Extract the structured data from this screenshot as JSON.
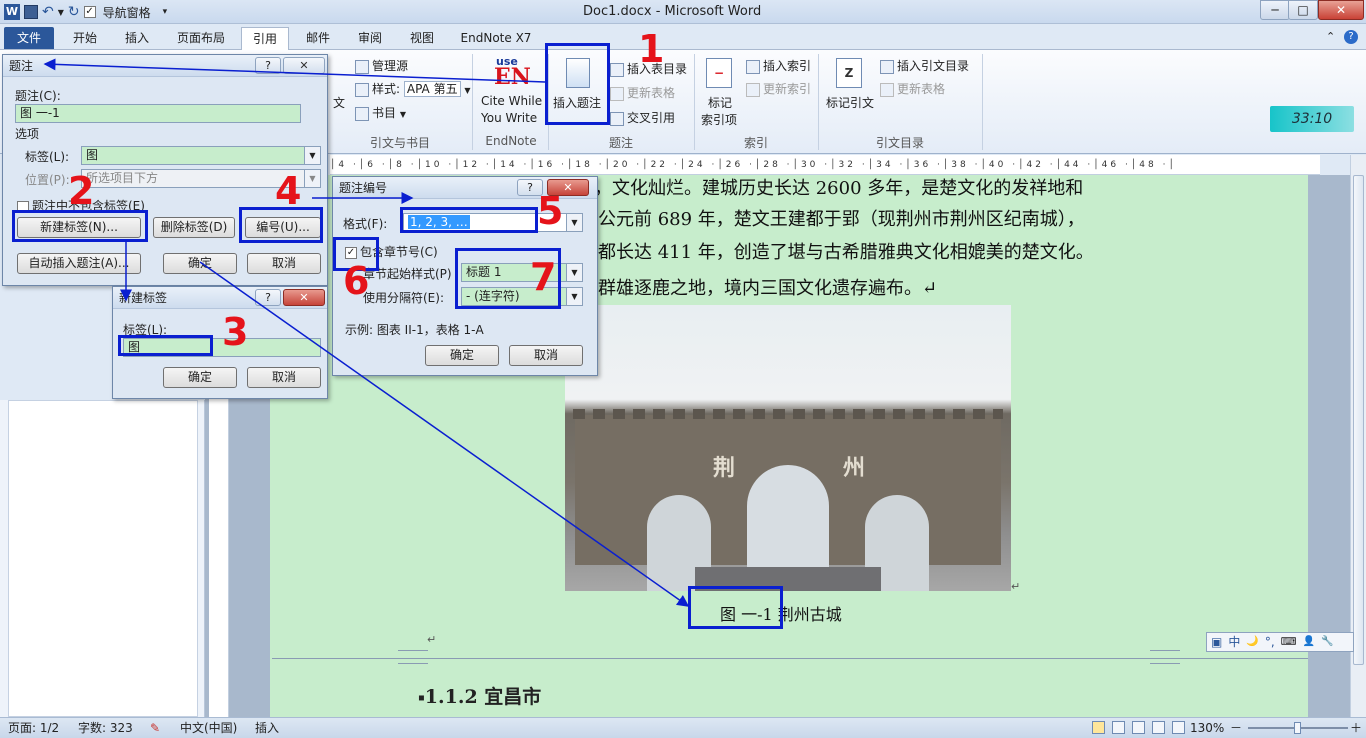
{
  "window": {
    "title": "Doc1.docx - Microsoft Word",
    "quick_access_label": "导航窗格",
    "word_icon": "W",
    "min": "─",
    "max": "□",
    "close": "✕"
  },
  "tabs": [
    "文件",
    "开始",
    "插入",
    "页面布局",
    "引用",
    "邮件",
    "审阅",
    "视图",
    "EndNote X7"
  ],
  "ribbon": {
    "citations": {
      "manage": "管理源",
      "style_label": "样式:",
      "style_value": "APA 第五",
      "bib": "书目",
      "group": "引文与书目",
      "partial": "文"
    },
    "endnote": {
      "logo_top": "use",
      "logo": "EN",
      "line1": "Cite While",
      "line2": "You Write",
      "group": "EndNote"
    },
    "captions": {
      "insert_caption": "插入题注",
      "insert_table_figures": "插入表目录",
      "update_table": "更新表格",
      "cross_ref": "交叉引用",
      "group": "题注"
    },
    "index": {
      "insert_index": "插入索引",
      "update_index": "更新索引",
      "mark_entry_1": "标记",
      "mark_entry_2": "索引项",
      "group": "索引"
    },
    "toa": {
      "insert_toa": "插入引文目录",
      "update_table": "更新表格",
      "mark_citation": "标记引文",
      "group": "引文目录"
    }
  },
  "timer": "33:10",
  "ruler_text": "│4 ·│6 ·│8 ·│10 ·│12 ·│14 ·│16 ·│18 ·│20 ·│22 ·│24 ·│26 ·│28 ·│30 ·│32 ·│34 ·│36 ·│38 ·│40 ·│42 ·│44 ·│46 ·│48 ·│",
  "document": {
    "line1": "，文化灿烂。建城历史长达 2600 多年，是楚文化的发祥地和",
    "line2": "公元前 689 年，楚文王建都于郢（现荆州市荆州区纪南城），",
    "line3": "都长达 411 年，创造了堪与古希腊雅典文化相媲美的楚文化。",
    "line4": "群雄逐鹿之地，境内三国文化遗存遍布。↵",
    "photo_sign_left": "荆",
    "photo_sign_right": "州",
    "caption": "图  一-1 荆州古城",
    "heading": "1.1.2 宜昌市",
    "para_mark": "↵"
  },
  "ime": [
    "中",
    "🌙",
    "°,",
    "⌨",
    "👤",
    "🔧"
  ],
  "caption_dialog": {
    "title": "题注",
    "q": "?",
    "x": "✕",
    "caption_label": "题注(C):",
    "caption_value": "图  一-1",
    "options": "选项",
    "label_label": "标签(L):",
    "label_value": "图",
    "position_label": "位置(P):",
    "position_value": "所选项目下方",
    "exclude_label": "题注中不包含标签(E)",
    "new_label": "新建标签(N)...",
    "delete_label": "删除标签(D)",
    "numbering": "编号(U)...",
    "autocaption": "自动插入题注(A)...",
    "ok": "确定",
    "cancel": "取消"
  },
  "new_label_dialog": {
    "title": "新建标签",
    "q": "?",
    "x": "✕",
    "label": "标签(L):",
    "value": "图",
    "ok": "确定",
    "cancel": "取消"
  },
  "numbering_dialog": {
    "title": "题注编号",
    "q": "?",
    "x": "✕",
    "format_label": "格式(F):",
    "format_value": "1, 2, 3, …",
    "include_chapter": "包含章节号(C)",
    "chapter_style_label": "章节起始样式(P)",
    "chapter_style_value": "标题 1",
    "separator_label": "使用分隔符(E):",
    "separator_value": "-   (连字符)",
    "example": "示例:  图表 II-1，表格 1-A",
    "ok": "确定",
    "cancel": "取消"
  },
  "annotations": [
    "1",
    "2",
    "3",
    "4",
    "5",
    "6",
    "7"
  ],
  "status": {
    "page": "页面: 1/2",
    "words": "字数: 323",
    "lang": "中文(中国)",
    "mode": "插入",
    "zoom": "130%",
    "minus": "－",
    "plus": "＋"
  }
}
